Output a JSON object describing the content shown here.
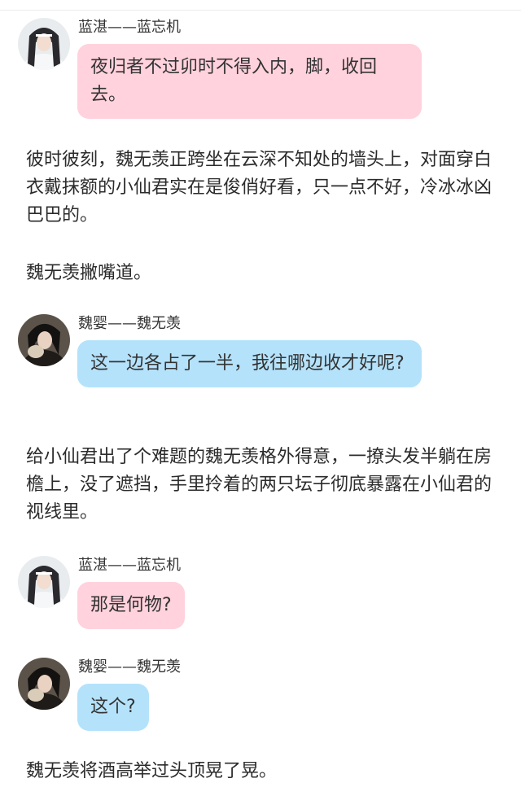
{
  "speakers": {
    "lwj": {
      "name": "蓝湛——蓝忘机",
      "avatar_icon": "lan-wangji-avatar-icon",
      "bubble_color": "#ffd2dd"
    },
    "wwx": {
      "name": "魏婴——魏无羡",
      "avatar_icon": "wei-wuxian-avatar-icon",
      "bubble_color": "#b5e2fb"
    }
  },
  "messages": [
    {
      "speaker": "蓝湛——蓝忘机",
      "text": "夜归者不过卯时不得入内，脚，收回去。"
    },
    {
      "speaker": "魏婴——魏无羡",
      "text": "这一边各占了一半，我往哪边收才好呢?"
    },
    {
      "speaker": "蓝湛——蓝忘机",
      "text": "那是何物?"
    },
    {
      "speaker": "魏婴——魏无羡",
      "text": "这个?"
    }
  ],
  "narrations": [
    "彼时彼刻，魏无羡正跨坐在云深不知处的墙头上，对面穿白衣戴抹额的小仙君实在是俊俏好看，只一点不好，冷冰冰凶巴巴的。",
    "魏无羡撇嘴道。",
    "给小仙君出了个难题的魏无羡格外得意，一撩头发半躺在房檐上，没了遮挡，手里拎着的两只坛子彻底暴露在小仙君的视线里。",
    "魏无羡将酒高举过头顶晃了晃。"
  ]
}
